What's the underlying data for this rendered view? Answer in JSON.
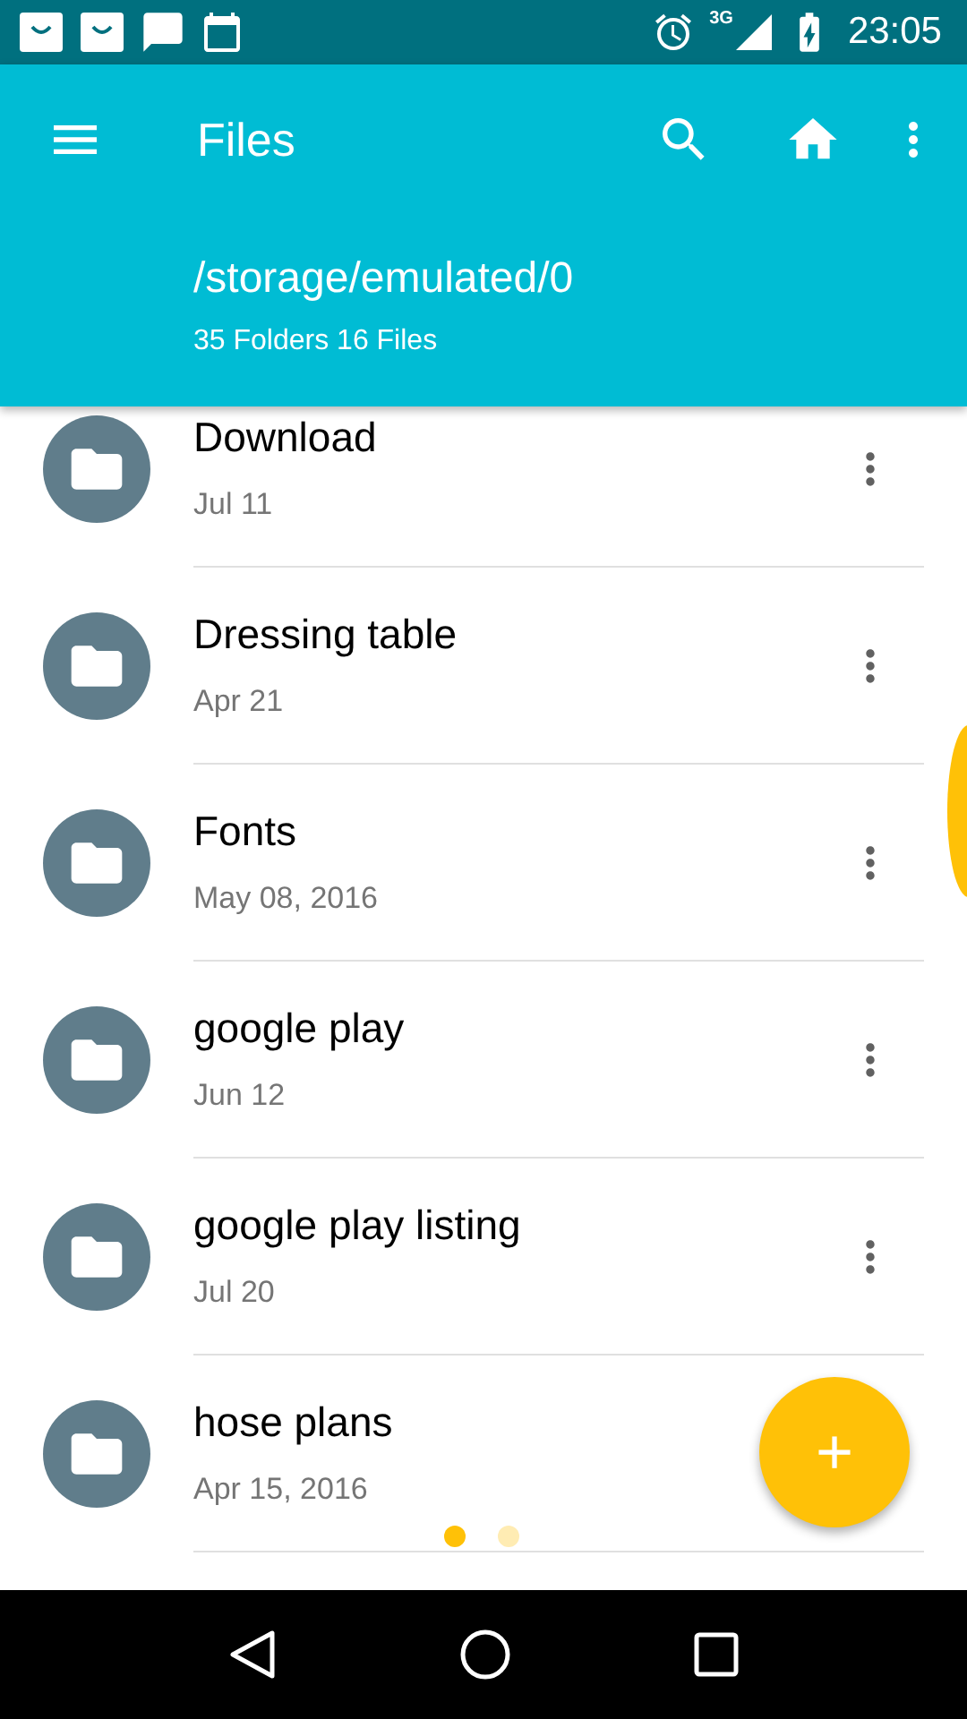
{
  "status_bar": {
    "time": "23:05",
    "network": "3G"
  },
  "app_bar": {
    "title": "Files",
    "path": "/storage/emulated/0",
    "summary": "35 Folders 16 Files"
  },
  "items": [
    {
      "name": "Download",
      "date": "Jul 11"
    },
    {
      "name": "Dressing table",
      "date": "Apr 21"
    },
    {
      "name": "Fonts",
      "date": "May 08, 2016"
    },
    {
      "name": "google play",
      "date": "Jun 12"
    },
    {
      "name": "google play listing",
      "date": "Jul 20"
    },
    {
      "name": "hose plans",
      "date": "Apr 15, 2016"
    }
  ],
  "fab": {
    "label": "+"
  },
  "page_dots": [
    {
      "selected": true
    },
    {
      "selected": false
    }
  ]
}
